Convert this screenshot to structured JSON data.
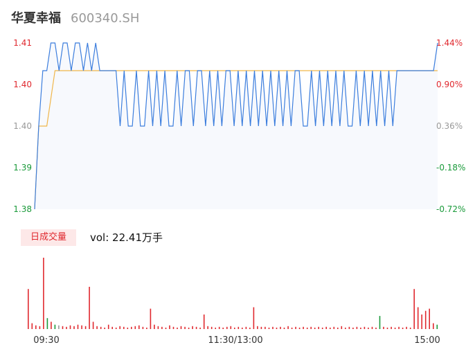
{
  "header": {
    "name": "华夏幸福",
    "code": "600340.SH"
  },
  "volume_panel": {
    "tag": "日成交量",
    "vol_prefix": "vol: ",
    "vol_value": "22.41万手"
  },
  "colors": {
    "up": "#e0282e",
    "down": "#1a9a3a",
    "neutral": "#999999",
    "price": "#3b7ddd",
    "avg": "#f0b64a",
    "area": "#f7f9fd"
  },
  "chart_data": [
    {
      "type": "line",
      "title": "",
      "left_ticks": [
        "1.41",
        "1.40",
        "1.40",
        "1.39",
        "1.38"
      ],
      "right_ticks": [
        "1.44%",
        "0.90%",
        "0.36%",
        "-0.18%",
        "-0.72%"
      ],
      "ylim": [
        1.38,
        1.41
      ],
      "series": [
        {
          "values": [
            1.38,
            1.395,
            1.405,
            1.405,
            1.41,
            1.41,
            1.405,
            1.41,
            1.41,
            1.405,
            1.41,
            1.41,
            1.405,
            1.41,
            1.405,
            1.41,
            1.405,
            1.405,
            1.405,
            1.405,
            1.405,
            1.395,
            1.405,
            1.395,
            1.395,
            1.405,
            1.395,
            1.395,
            1.405,
            1.395,
            1.405,
            1.395,
            1.405,
            1.395,
            1.395,
            1.405,
            1.395,
            1.405,
            1.405,
            1.395,
            1.405,
            1.405,
            1.395,
            1.405,
            1.395,
            1.405,
            1.395,
            1.405,
            1.405,
            1.395,
            1.405,
            1.395,
            1.405,
            1.395,
            1.405,
            1.395,
            1.405,
            1.395,
            1.405,
            1.395,
            1.405,
            1.395,
            1.405,
            1.395,
            1.405,
            1.405,
            1.395,
            1.395,
            1.405,
            1.395,
            1.405,
            1.395,
            1.405,
            1.395,
            1.405,
            1.395,
            1.405,
            1.395,
            1.395,
            1.405,
            1.395,
            1.405,
            1.395,
            1.405,
            1.395,
            1.405,
            1.395,
            1.405,
            1.395,
            1.405,
            1.405,
            1.405,
            1.405,
            1.405,
            1.405,
            1.405,
            1.405,
            1.405,
            1.405,
            1.41
          ]
        },
        {
          "values": [
            1.38,
            1.395,
            1.395,
            1.395,
            1.4,
            1.405,
            1.405,
            1.405,
            1.405,
            1.405,
            1.405,
            1.405,
            1.405,
            1.405,
            1.405,
            1.405,
            1.405,
            1.405,
            1.405,
            1.405,
            1.405,
            1.405,
            1.405,
            1.405,
            1.405,
            1.405,
            1.405,
            1.405,
            1.405,
            1.405,
            1.405,
            1.405,
            1.405,
            1.405,
            1.405,
            1.405,
            1.405,
            1.405,
            1.405,
            1.405,
            1.405,
            1.405,
            1.405,
            1.405,
            1.405,
            1.405,
            1.405,
            1.405,
            1.405,
            1.405,
            1.405,
            1.405,
            1.405,
            1.405,
            1.405,
            1.405,
            1.405,
            1.405,
            1.405,
            1.405,
            1.405,
            1.405,
            1.405,
            1.405,
            1.405,
            1.405,
            1.405,
            1.405,
            1.405,
            1.405,
            1.405,
            1.405,
            1.405,
            1.405,
            1.405,
            1.405,
            1.405,
            1.405,
            1.405,
            1.405,
            1.405,
            1.405,
            1.405,
            1.405,
            1.405,
            1.405,
            1.405,
            1.405,
            1.405,
            1.405,
            1.405,
            1.405,
            1.405,
            1.405,
            1.405,
            1.405,
            1.405,
            1.405,
            1.405,
            1.405
          ]
        }
      ]
    },
    {
      "type": "bar",
      "title": "",
      "x_ticks": [
        "09:30",
        "11:30/13:00",
        "15:00"
      ],
      "values": [
        55,
        8,
        5,
        4,
        98,
        15,
        10,
        6,
        5,
        4,
        3,
        5,
        4,
        6,
        5,
        4,
        58,
        10,
        4,
        3,
        2,
        6,
        3,
        2,
        4,
        3,
        2,
        3,
        4,
        5,
        3,
        2,
        28,
        6,
        4,
        3,
        2,
        5,
        3,
        2,
        4,
        3,
        2,
        4,
        3,
        2,
        20,
        4,
        3,
        2,
        3,
        2,
        3,
        4,
        2,
        3,
        2,
        3,
        2,
        30,
        4,
        3,
        3,
        2,
        3,
        2,
        3,
        2,
        4,
        2,
        3,
        2,
        3,
        2,
        3,
        2,
        3,
        2,
        3,
        2,
        3,
        2,
        4,
        2,
        3,
        2,
        3,
        2,
        3,
        2,
        3,
        2,
        18,
        3,
        2,
        3,
        2,
        3,
        2,
        3,
        2,
        55,
        30,
        20,
        25,
        28,
        8,
        6
      ],
      "colors": [
        "up",
        "up",
        "up",
        "up",
        "up",
        "down",
        "up",
        "down",
        "neutral",
        "up",
        "up",
        "up",
        "up",
        "up",
        "up",
        "up",
        "up",
        "up",
        "up",
        "up",
        "up",
        "up",
        "up",
        "up",
        "up",
        "up",
        "up",
        "up",
        "up",
        "up",
        "up",
        "up",
        "up",
        "up",
        "up",
        "up",
        "up",
        "up",
        "up",
        "up",
        "up",
        "up",
        "up",
        "up",
        "up",
        "up",
        "up",
        "up",
        "up",
        "up",
        "up",
        "up",
        "up",
        "up",
        "up",
        "up",
        "up",
        "up",
        "up",
        "up",
        "up",
        "up",
        "up",
        "up",
        "up",
        "up",
        "up",
        "up",
        "up",
        "up",
        "up",
        "up",
        "up",
        "up",
        "up",
        "up",
        "up",
        "up",
        "up",
        "up",
        "up",
        "up",
        "up",
        "up",
        "up",
        "up",
        "up",
        "up",
        "up",
        "up",
        "up",
        "up",
        "down",
        "up",
        "up",
        "up",
        "up",
        "up",
        "up",
        "up",
        "up",
        "up",
        "up",
        "up",
        "up",
        "up",
        "up",
        "down"
      ]
    }
  ]
}
